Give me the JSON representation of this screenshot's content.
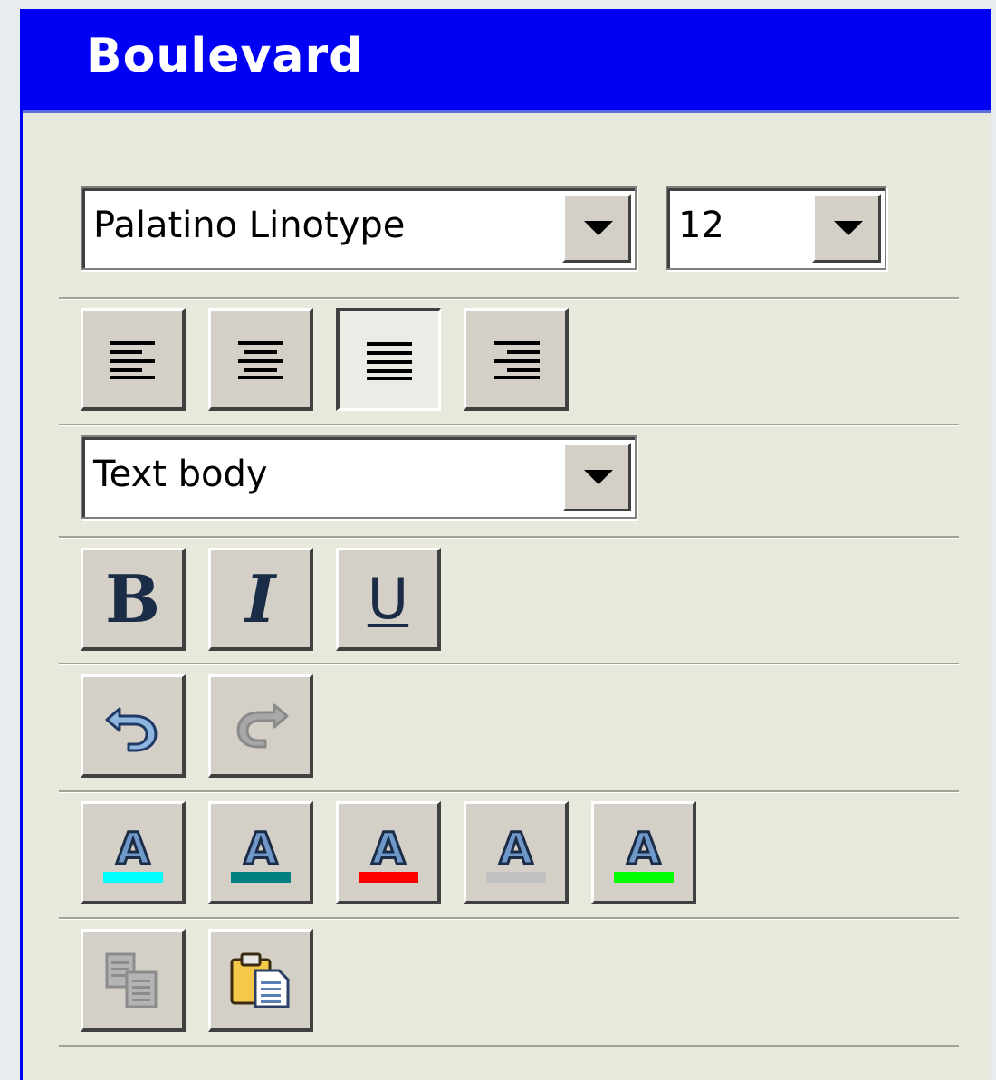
{
  "window": {
    "title": "Boulevard"
  },
  "font": {
    "family_value": "Palatino Linotype",
    "size_value": "12"
  },
  "alignment": {
    "buttons": [
      {
        "id": "align-left",
        "icon": "align-left-icon"
      },
      {
        "id": "align-center",
        "icon": "align-center-icon"
      },
      {
        "id": "align-justify",
        "icon": "align-justify-icon",
        "pressed": true
      },
      {
        "id": "align-right",
        "icon": "align-right-icon"
      }
    ]
  },
  "paragraph_style": {
    "value": "Text body"
  },
  "text_format": {
    "bold_glyph": "B",
    "italic_glyph": "I",
    "underline_glyph": "U"
  },
  "history": {
    "undo_icon": "undo-icon",
    "redo_icon": "redo-icon",
    "redo_enabled": false
  },
  "font_colors": [
    {
      "glyph": "A",
      "bar_color": "#00ffff"
    },
    {
      "glyph": "A",
      "bar_color": "#008080"
    },
    {
      "glyph": "A",
      "bar_color": "#ff0000"
    },
    {
      "glyph": "A",
      "bar_color": "#c0c0c0"
    },
    {
      "glyph": "A",
      "bar_color": "#00ff00"
    }
  ],
  "clipboard": {
    "copy_icon": "copy-icon",
    "paste_icon": "paste-icon",
    "copy_enabled": false
  },
  "colors": {
    "title_bar": "#0000f5",
    "panel": "#e8e8dd",
    "button_face": "#d4d0c8"
  }
}
